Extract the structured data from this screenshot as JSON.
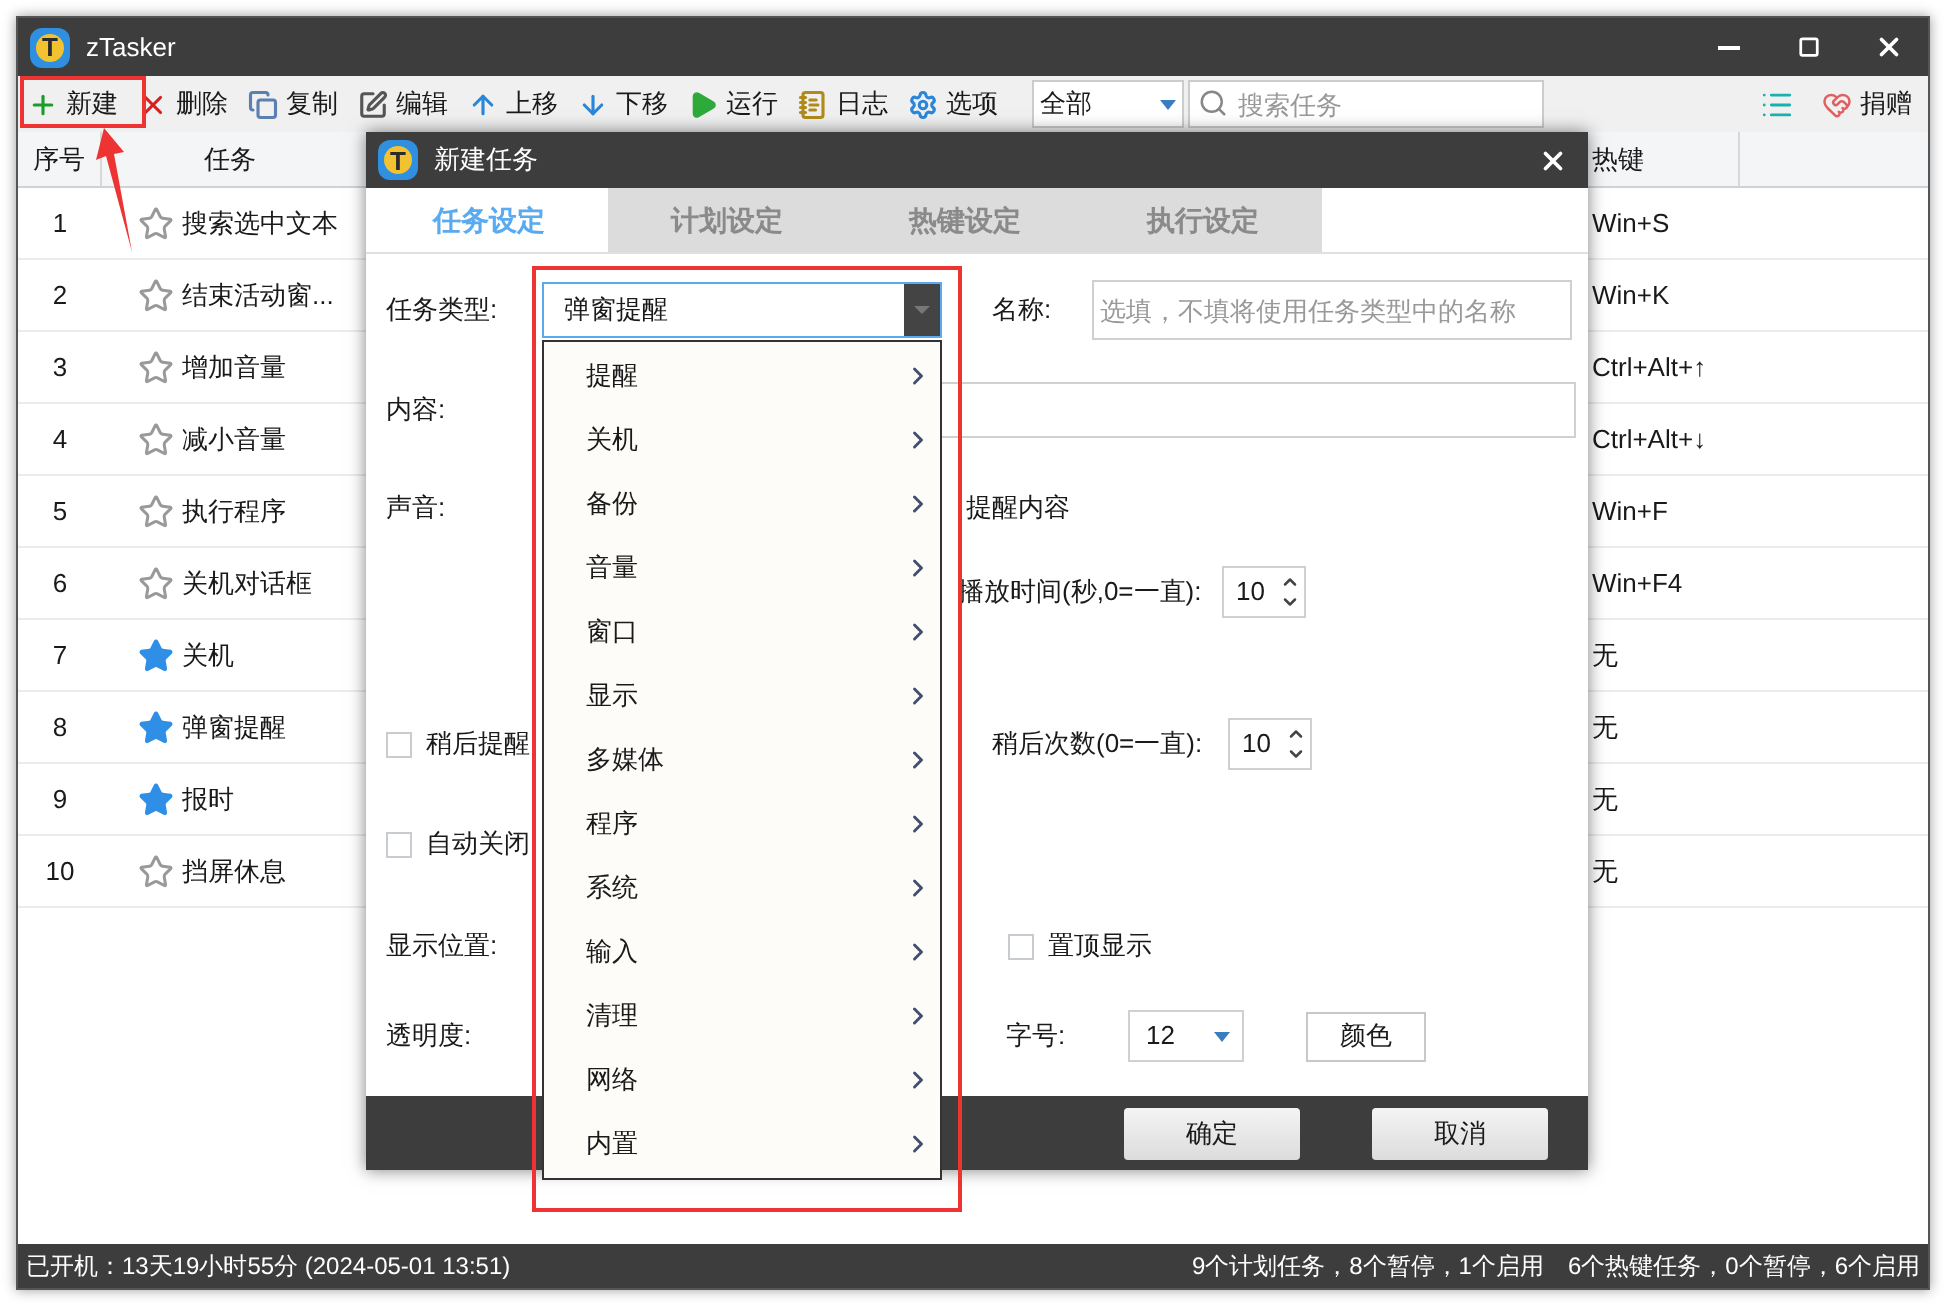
{
  "window": {
    "logo": "T",
    "title": "zTasker"
  },
  "toolbar": {
    "buttons": [
      {
        "label": "新建"
      },
      {
        "label": "删除"
      },
      {
        "label": "复制"
      },
      {
        "label": "编辑"
      },
      {
        "label": "上移"
      },
      {
        "label": "下移"
      },
      {
        "label": "运行"
      },
      {
        "label": "日志"
      },
      {
        "label": "选项"
      }
    ],
    "filter": "全部",
    "search": {
      "placeholder": "搜索任务"
    },
    "donate": "捐赠"
  },
  "table": {
    "columns": [
      "序号",
      "任务",
      "热键"
    ],
    "rows": [
      {
        "index": "1",
        "task": "搜索选中文本",
        "starred": false,
        "hotkey": "Win+S"
      },
      {
        "index": "2",
        "task": "结束活动窗...",
        "starred": false,
        "hotkey": "Win+K"
      },
      {
        "index": "3",
        "task": "增加音量",
        "starred": false,
        "hotkey": "Ctrl+Alt+↑"
      },
      {
        "index": "4",
        "task": "减小音量",
        "starred": false,
        "hotkey": "Ctrl+Alt+↓"
      },
      {
        "index": "5",
        "task": "执行程序",
        "starred": false,
        "hotkey": "Win+F"
      },
      {
        "index": "6",
        "task": "关机对话框",
        "starred": false,
        "hotkey": "Win+F4"
      },
      {
        "index": "7",
        "task": "关机",
        "starred": true,
        "hotkey": "无"
      },
      {
        "index": "8",
        "task": "弹窗提醒",
        "starred": true,
        "hotkey": "无"
      },
      {
        "index": "9",
        "task": "报时",
        "starred": true,
        "hotkey": "无"
      },
      {
        "index": "10",
        "task": "挡屏休息",
        "starred": false,
        "hotkey": "无"
      }
    ]
  },
  "dialog": {
    "logo": "T",
    "title": "新建任务",
    "tabs": [
      {
        "label": "任务设定",
        "selected": true
      },
      {
        "label": "计划设定",
        "selected": false
      },
      {
        "label": "热键设定",
        "selected": false
      },
      {
        "label": "执行设定",
        "selected": false
      }
    ],
    "task_type_label": "任务类型:",
    "task_type": "弹窗提醒",
    "name_label": "名称:",
    "name_placeholder": "选填，不填将使用任务类型中的名称",
    "content_label": "内容:",
    "sound_label": "声音:",
    "read_aloud": "提醒内容",
    "play_time_label": "播放时间(秒,0=一直):",
    "play_time": "10",
    "snooze": {
      "label": "稍后提醒",
      "checked": false
    },
    "snooze_count_label": "稍后次数(0=一直):",
    "snooze_count": "10",
    "auto_close": {
      "label": "自动关闭",
      "checked": false
    },
    "position_label": "显示位置:",
    "always_on_top": {
      "label": "置顶显示",
      "checked": false
    },
    "opacity_label": "透明度:",
    "font_size_label": "字号:",
    "font_size": "12",
    "color_button": "颜色",
    "ok": "确定",
    "cancel": "取消",
    "menu": [
      {
        "label": "提醒"
      },
      {
        "label": "关机"
      },
      {
        "label": "备份"
      },
      {
        "label": "音量"
      },
      {
        "label": "窗口"
      },
      {
        "label": "显示"
      },
      {
        "label": "多媒体"
      },
      {
        "label": "程序"
      },
      {
        "label": "系统"
      },
      {
        "label": "输入"
      },
      {
        "label": "清理"
      },
      {
        "label": "网络"
      },
      {
        "label": "内置"
      }
    ]
  },
  "status_bar": {
    "uptime": "已开机：13天19小时55分 (2024-05-01 13:51)",
    "plan_tasks": "9个计划任务，8个暂停，1个启用",
    "hotkey_tasks": "6个热键任务，0个暂停，6个启用"
  }
}
